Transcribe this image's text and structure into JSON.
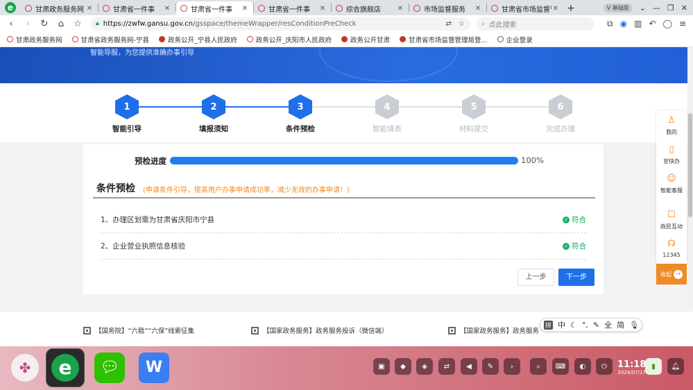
{
  "browser": {
    "tabs": [
      {
        "label": "甘肃政务服务网",
        "active": false
      },
      {
        "label": "甘肃省一件事",
        "active": false
      },
      {
        "label": "甘肃省一件事",
        "active": true
      },
      {
        "label": "甘肃省一件事",
        "active": false
      },
      {
        "label": "综合旗舰店",
        "active": false
      },
      {
        "label": "市场监督服务",
        "active": false
      },
      {
        "label": "甘肃省市场监督管",
        "active": false
      }
    ],
    "version_badge": "V 基础版",
    "url_host": "https://zwfw.gansu.gov.cn",
    "url_path": "/gsspace/themeWrapper/resConditionPreCheck",
    "search_placeholder": "点此搜索",
    "bookmarks": [
      "甘肃政务服务网",
      "甘肃省政务服务网-宁县",
      "政务公开_宁县人民政府",
      "政务公开_庆阳市人民政府",
      "政务公开甘肃",
      "甘肃省市场监督管理局登...",
      "企业登录"
    ]
  },
  "page": {
    "banner_text": "智能导服，为您提供准确办事引导",
    "steps": [
      {
        "num": "1",
        "label": "智能引导",
        "done": true
      },
      {
        "num": "2",
        "label": "填报须知",
        "done": true
      },
      {
        "num": "3",
        "label": "条件预检",
        "done": true
      },
      {
        "num": "4",
        "label": "智能填表",
        "done": false
      },
      {
        "num": "5",
        "label": "材料提交",
        "done": false
      },
      {
        "num": "6",
        "label": "完成办理",
        "done": false
      }
    ],
    "progress_label": "预检进度",
    "progress_value": 100,
    "progress_text": "100%",
    "section_title": "条件预检",
    "section_subtitle": "(申请条件引导，提高用户办事申请成功率，减少无效的办事申请！)",
    "conditions": [
      {
        "text": "1、办理区划需为甘肃省庆阳市宁县",
        "status": "符合"
      },
      {
        "text": "2、企业营业执照信息核验",
        "status": "符合"
      }
    ],
    "prev_button": "上一步",
    "next_button": "下一步"
  },
  "side_panel": {
    "items": [
      "我的",
      "甘快办",
      "智能客服",
      "政民互动",
      "12345"
    ],
    "collapse": "收起"
  },
  "footer_links": [
    "【国务院】“六稳”“六保”线索征集",
    "【国家政务服务】政务服务投诉（微信端）",
    "【国家政务服务】政务服务"
  ],
  "ime": {
    "mode": "拼",
    "lang": "中",
    "simp": "简",
    "full": "全"
  },
  "taskbar": {
    "time": "11:18",
    "date": "2024/07/17"
  },
  "colors": {
    "primary": "#1e6fe8",
    "accent": "#f08a24",
    "ok": "#19a05a"
  }
}
